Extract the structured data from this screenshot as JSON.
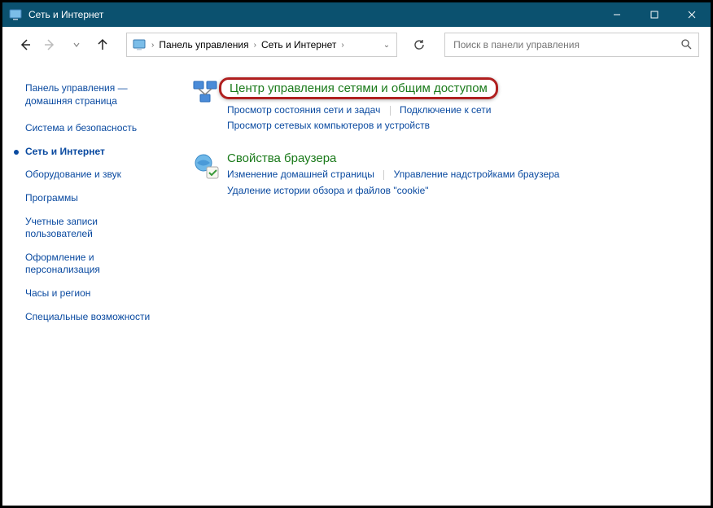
{
  "titlebar": {
    "title": "Сеть и Интернет"
  },
  "breadcrumb": {
    "items": [
      "Панель управления",
      "Сеть и Интернет"
    ]
  },
  "search": {
    "placeholder": "Поиск в панели управления"
  },
  "sidebar": {
    "home": "Панель управления — домашняя страница",
    "items": [
      "Система и безопасность",
      "Сеть и Интернет",
      "Оборудование и звук",
      "Программы",
      "Учетные записи пользователей",
      "Оформление и персонализация",
      "Часы и регион",
      "Специальные возможности"
    ],
    "currentIndex": 1
  },
  "main": {
    "network_center": {
      "title": "Центр управления сетями и общим доступом",
      "links": [
        "Просмотр состояния сети и задач",
        "Подключение к сети",
        "Просмотр сетевых компьютеров и устройств"
      ]
    },
    "browser_props": {
      "title": "Свойства браузера",
      "links": [
        "Изменение домашней страницы",
        "Управление надстройками браузера",
        "Удаление истории обзора и файлов \"cookie\""
      ]
    }
  }
}
